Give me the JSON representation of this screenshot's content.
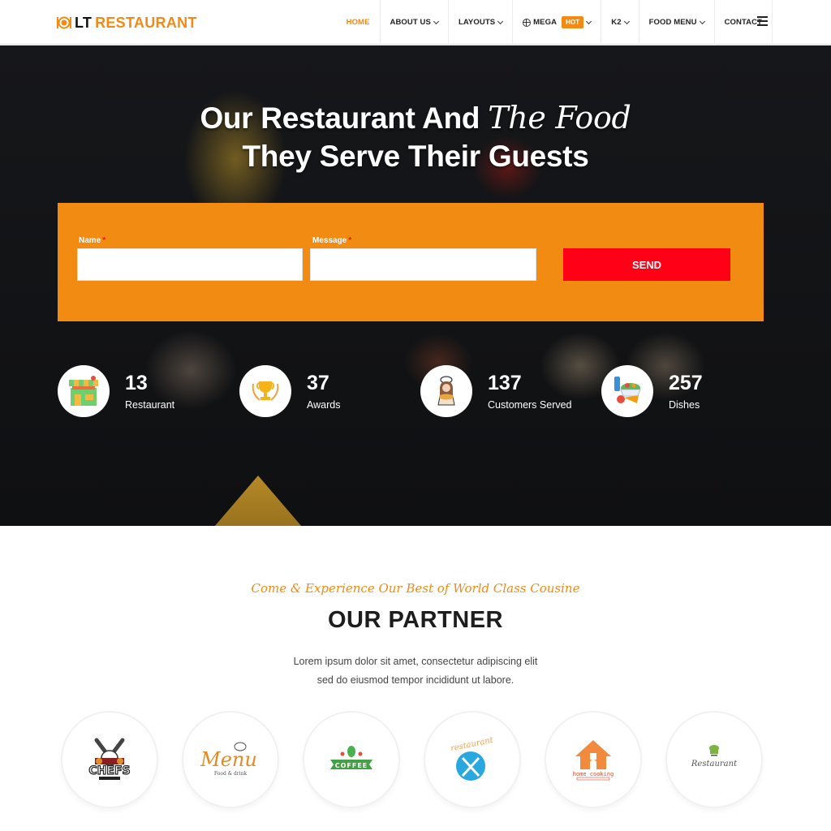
{
  "brand": {
    "prefix": "LT",
    "name": "RESTAURANT",
    "accent_color": "#f28a13"
  },
  "nav": {
    "items": [
      {
        "label": "HOME",
        "active": true,
        "has_dropdown": false
      },
      {
        "label": "ABOUT US",
        "active": false,
        "has_dropdown": true
      },
      {
        "label": "LAYOUTS",
        "active": false,
        "has_dropdown": true
      },
      {
        "label": "MEGA",
        "active": false,
        "has_dropdown": true,
        "badge": "HOT",
        "icon": "mega-globe-icon"
      },
      {
        "label": "K2",
        "active": false,
        "has_dropdown": true
      },
      {
        "label": "FOOD MENU",
        "active": false,
        "has_dropdown": true
      },
      {
        "label": "CONTACT",
        "active": false,
        "has_dropdown": false
      }
    ],
    "menu_icon": "hamburger-icon"
  },
  "hero": {
    "title_part1": "Our Restaurant And ",
    "title_script": "The Food",
    "title_line2": "They Serve Their Guests"
  },
  "form": {
    "name_label": "Name",
    "message_label": "Message",
    "required_mark": "*",
    "name_value": "",
    "message_value": "",
    "send_label": "SEND",
    "box_color": "#f28b12",
    "button_color": "#ff0016"
  },
  "stats": [
    {
      "value": "13",
      "label": "Restaurant",
      "icon": "storefront-icon"
    },
    {
      "value": "37",
      "label": "Awards",
      "icon": "trophy-icon"
    },
    {
      "value": "137",
      "label": "Customers Served",
      "icon": "chef-icon"
    },
    {
      "value": "257",
      "label": "Dishes",
      "icon": "groceries-icon"
    }
  ],
  "partner": {
    "tagline": "Come & Experience Our Best of World Class Cousine",
    "title": "OUR PARTNER",
    "desc_line1": "Lorem ipsum dolor sit amet, consectetur adipiscing elit",
    "desc_line2": "sed do eiusmod tempor incididunt ut labore.",
    "logos": [
      {
        "name": "CHEFS",
        "icon": "chefs-logo-icon"
      },
      {
        "name": "Menu",
        "sub": "Food & drink",
        "icon": "menu-logo-icon"
      },
      {
        "name": "COFFEE",
        "icon": "coffee-logo-icon"
      },
      {
        "name": "restaurant",
        "icon": "cutlery-logo-icon"
      },
      {
        "name": "home cooking",
        "icon": "home-cooking-logo-icon"
      },
      {
        "name": "Restaurant",
        "icon": "chef-hat-logo-icon"
      }
    ]
  }
}
